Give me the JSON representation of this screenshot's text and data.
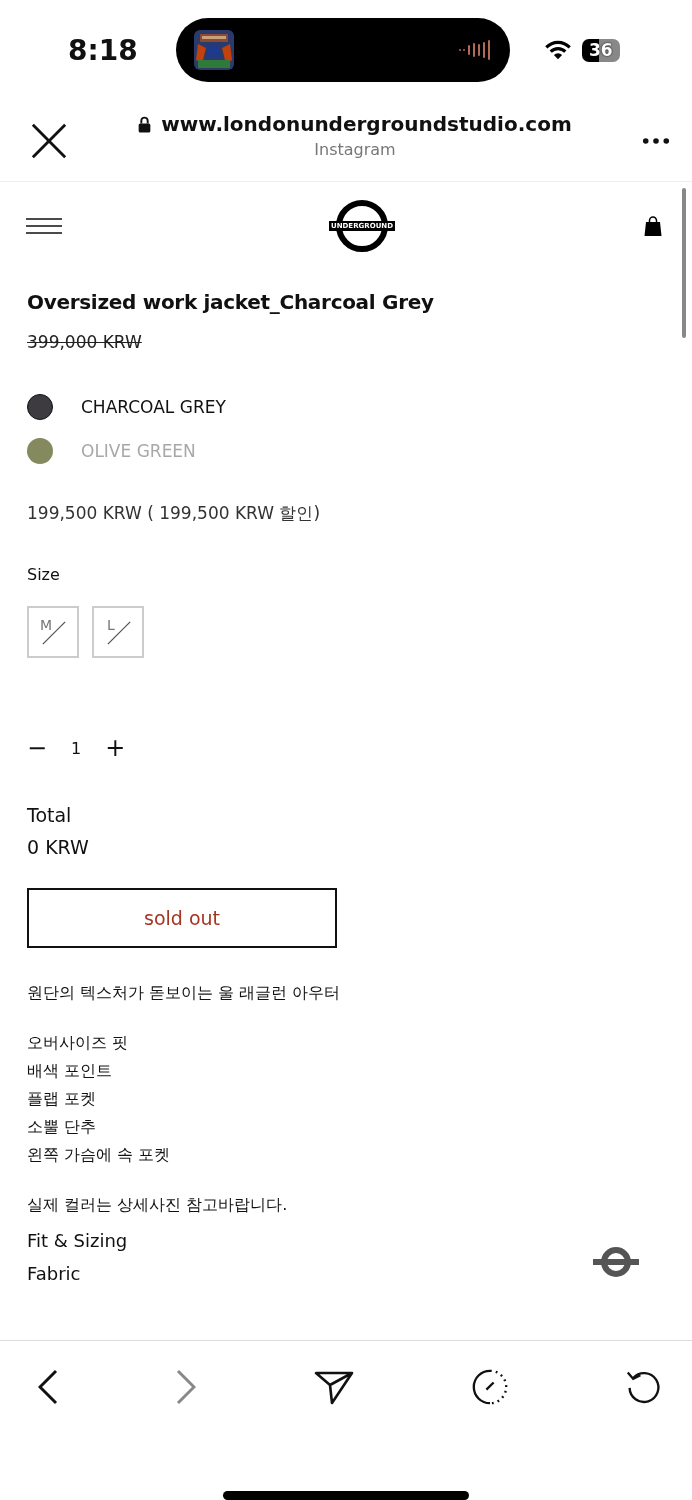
{
  "status_bar": {
    "time": "8:18",
    "battery": "36"
  },
  "browser": {
    "url": "www.londonundergroundstudio.com",
    "source": "Instagram"
  },
  "logo": {
    "text": "UNDERGROUND"
  },
  "product": {
    "title": "Oversized work jacket_Charcoal Grey",
    "original_price": "399,000 KRW",
    "colors": [
      {
        "label": "CHARCOAL GREY",
        "color": "#3d3a40",
        "disabled": false
      },
      {
        "label": "OLIVE GREEN",
        "color": "#858a5e",
        "disabled": true
      }
    ],
    "sale_price": "199,500 KRW ( 199,500 KRW 할인)",
    "size_label": "Size",
    "sizes": [
      {
        "label": "M",
        "disabled": true
      },
      {
        "label": "L",
        "disabled": true
      }
    ],
    "quantity": {
      "minus": "−",
      "value": "1",
      "plus": "+"
    },
    "total_label": "Total",
    "total_value": "0 KRW",
    "button": "sold out",
    "description": [
      [
        "원단의 텍스처가 돋보이는 울 래글런 아우터"
      ],
      [
        "오버사이즈 핏",
        "배색 포인트",
        "플랩 포켓",
        "소뿔 단추",
        "왼쪽 가슴에 속 포켓"
      ],
      [
        "실제 컬러는 상세사진 참고바랍니다."
      ]
    ],
    "sections": [
      "Fit & Sizing",
      "Fabric"
    ]
  },
  "toolbar": [
    {
      "kind": "back",
      "disabled": false
    },
    {
      "kind": "forward",
      "disabled": true
    },
    {
      "kind": "share",
      "disabled": false
    },
    {
      "kind": "timer",
      "disabled": false
    },
    {
      "kind": "reload",
      "disabled": false
    }
  ]
}
